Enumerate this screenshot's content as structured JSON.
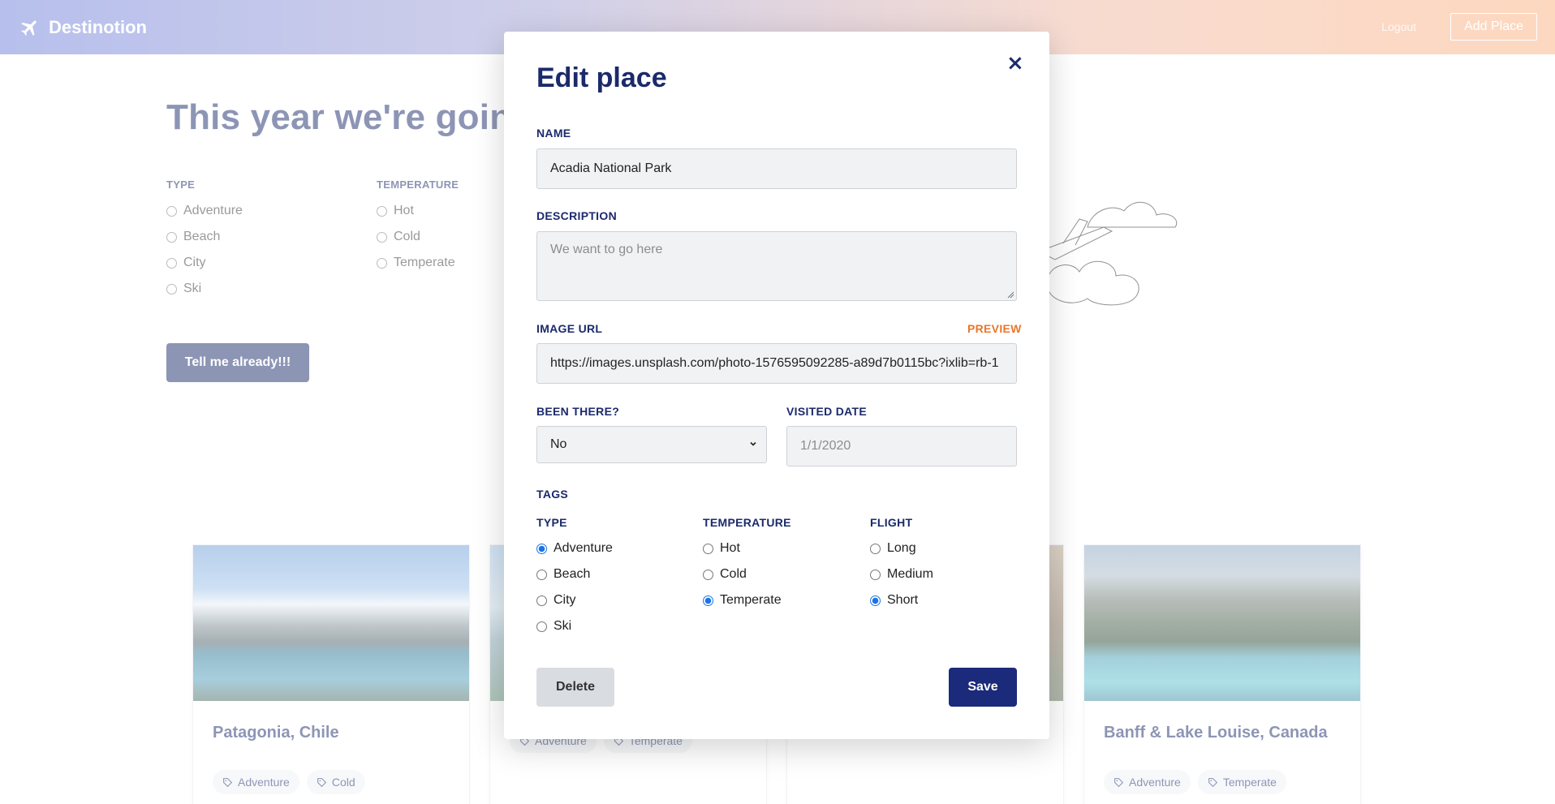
{
  "app": {
    "name": "Destinotion"
  },
  "nav": {
    "logout": "Logout",
    "add_place": "Add Place"
  },
  "hero": {
    "title": "This year we're going t"
  },
  "filters": {
    "type": {
      "label": "TYPE",
      "options": [
        "Adventure",
        "Beach",
        "City",
        "Ski"
      ]
    },
    "temperature": {
      "label": "TEMPERATURE",
      "options": [
        "Hot",
        "Cold",
        "Temperate"
      ]
    },
    "submit": "Tell me already!!!"
  },
  "cards": [
    {
      "title": "Patagonia, Chile",
      "tags": [
        "Adventure",
        "Cold"
      ]
    },
    {
      "title": "",
      "tags": [
        "Adventure",
        "Temperate"
      ]
    },
    {
      "title": "",
      "tags": []
    },
    {
      "title": "Banff & Lake Louise, Canada",
      "tags": [
        "Adventure",
        "Temperate"
      ]
    }
  ],
  "modal": {
    "title": "Edit place",
    "close": "×",
    "name": {
      "label": "NAME",
      "value": "Acadia National Park"
    },
    "description": {
      "label": "DESCRIPTION",
      "placeholder": "We want to go here"
    },
    "image_url": {
      "label": "IMAGE URL",
      "preview": "PREVIEW",
      "value": "https://images.unsplash.com/photo-1576595092285-a89d7b0115bc?ixlib=rb-1"
    },
    "been_there": {
      "label": "BEEN THERE?",
      "value": "No"
    },
    "visited_date": {
      "label": "VISITED DATE",
      "placeholder": "1/1/2020"
    },
    "tags": {
      "label": "TAGS",
      "type": {
        "label": "TYPE",
        "options": [
          "Adventure",
          "Beach",
          "City",
          "Ski"
        ],
        "selected": "Adventure"
      },
      "temperature": {
        "label": "TEMPERATURE",
        "options": [
          "Hot",
          "Cold",
          "Temperate"
        ],
        "selected": "Temperate"
      },
      "flight": {
        "label": "FLIGHT",
        "options": [
          "Long",
          "Medium",
          "Short"
        ],
        "selected": "Short"
      }
    },
    "delete": "Delete",
    "save": "Save"
  },
  "colors": {
    "primary": "#1b2a7a",
    "accent": "#e8762b",
    "radio_selected": "#1a73e8"
  },
  "icons": {
    "brand": "airplane-icon",
    "close": "close-icon",
    "tag": "tag-icon",
    "select": "chevron-down-icon"
  }
}
